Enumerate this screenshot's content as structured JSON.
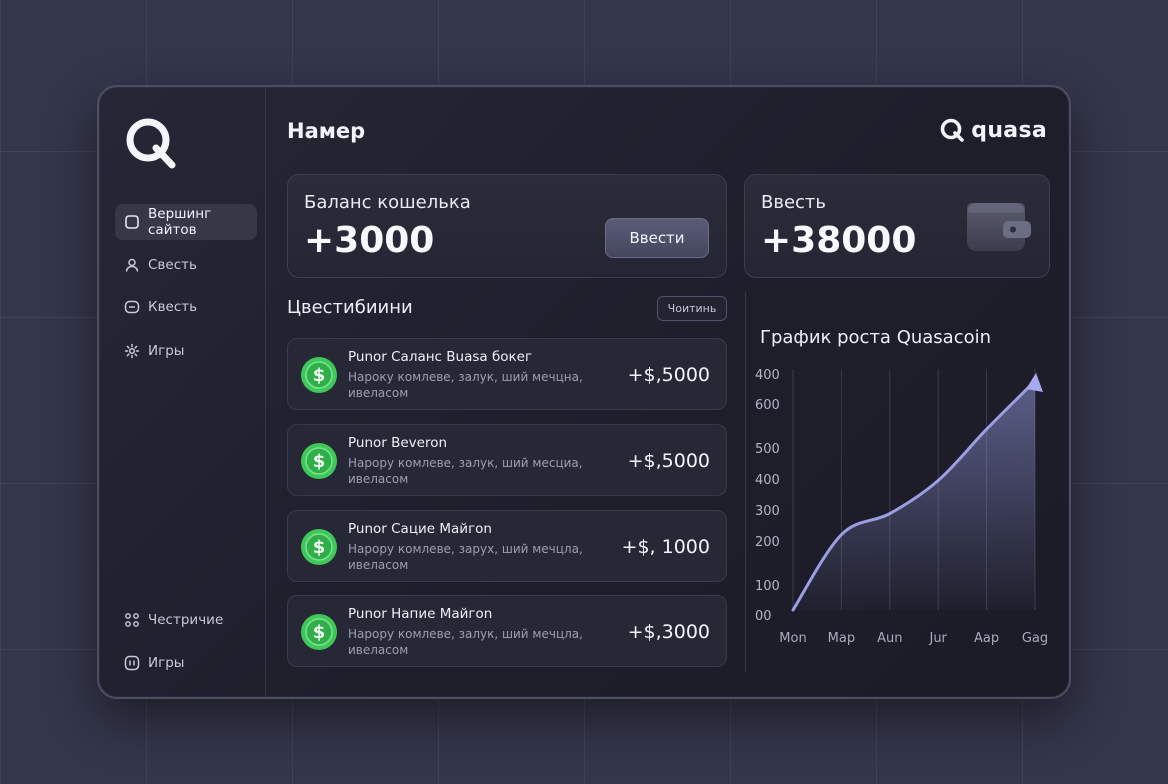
{
  "sidebar": {
    "items": [
      {
        "label": "Вершинг сайтов",
        "icon": "square-icon",
        "active": true
      },
      {
        "label": "Свесть",
        "icon": "user-icon"
      },
      {
        "label": "Квесть",
        "icon": "chat-icon"
      },
      {
        "label": "Игры",
        "icon": "gear-icon"
      }
    ],
    "bottom_items": [
      {
        "label": "Честричие",
        "icon": "grid-icon"
      },
      {
        "label": "Игры",
        "icon": "gamepad-icon"
      }
    ]
  },
  "header": {
    "title": "Намер",
    "brand": "quasa"
  },
  "balance_card": {
    "label": "Баланс кошелька",
    "value": "+3000",
    "button": "Ввести"
  },
  "deposit_card": {
    "label": "Ввесть",
    "value": "+38000",
    "icon": "wallet-icon"
  },
  "transactions": {
    "title": "Цвестибиини",
    "button": "Чоитинь",
    "items": [
      {
        "title": "Punor Саланс Buasa бокег",
        "desc": "Нароку комлеве, залук, ший мечцна, ивеласом",
        "amount": "+$,5000"
      },
      {
        "title": "Punor Beveron",
        "desc": "Нарору комлеве, залук, ший месциа, ивеласом",
        "amount": "+$,5000"
      },
      {
        "title": "Punor Сацие Майгоn",
        "desc": "Нарору комлеве, зарух, ший мечцла, ивеласом",
        "amount": "+$, 1000"
      },
      {
        "title": "Punor Напие Майгоn",
        "desc": "Нарору комлеве, залук, ший мечцла, ивеласом",
        "amount": "+$,3000"
      }
    ]
  },
  "colors": {
    "accent": "#8f92d6",
    "coin_green": "#3fc85a"
  },
  "chart_data": {
    "type": "area",
    "title": "График роста Quasacoin",
    "categories": [
      "Mon",
      "Map",
      "Aun",
      "Jur",
      "Aap",
      "Gag"
    ],
    "y_tick_labels": [
      "400",
      "600",
      "500",
      "400",
      "300",
      "200",
      "100",
      "00"
    ],
    "series": [
      {
        "values": [
          0,
          250,
          320,
          430,
          600,
          760
        ]
      }
    ],
    "grid": "vertical",
    "ylim": [
      0,
      780
    ]
  }
}
